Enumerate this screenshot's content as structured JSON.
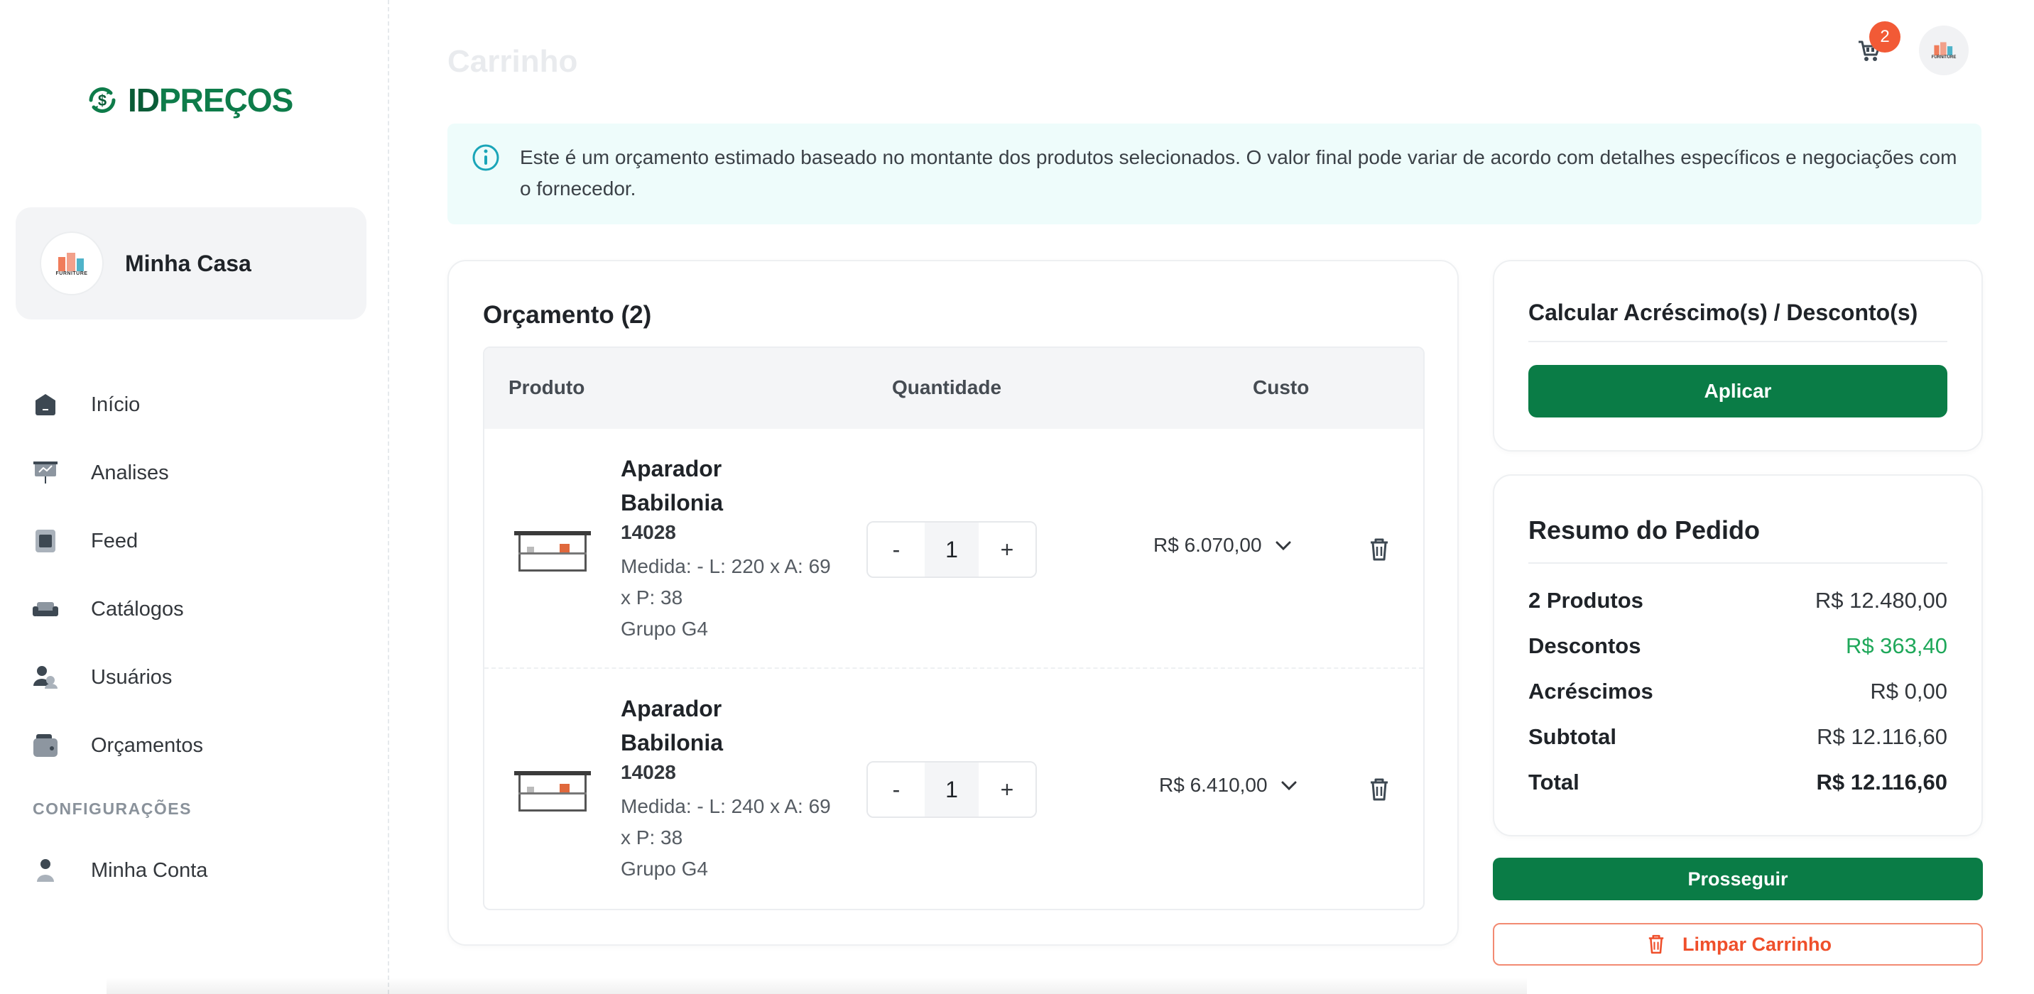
{
  "brand": {
    "prefix": "ID",
    "suffix": "PREÇOS",
    "color": "#0e7c4a"
  },
  "store": {
    "name": "Minha Casa",
    "avatar_text": "FURNITURE"
  },
  "nav": {
    "items": [
      {
        "label": "Início",
        "icon": "home-icon"
      },
      {
        "label": "Analises",
        "icon": "presentation-chart-icon"
      },
      {
        "label": "Feed",
        "icon": "feed-icon"
      },
      {
        "label": "Catálogos",
        "icon": "sofa-icon"
      },
      {
        "label": "Usuários",
        "icon": "users-icon"
      },
      {
        "label": "Orçamentos",
        "icon": "wallet-icon"
      }
    ],
    "section_label": "CONFIGURAÇÕES",
    "settings_items": [
      {
        "label": "Minha Conta",
        "icon": "user-icon"
      }
    ]
  },
  "header": {
    "title": "Carrinho",
    "cart_count": "2",
    "cart_icon": "cart-icon"
  },
  "banner": {
    "icon": "info-icon",
    "text": "Este é um orçamento estimado baseado no montante dos produtos selecionados. O valor final pode variar de acordo com detalhes específicos e negociações com o fornecedor."
  },
  "budget": {
    "title": "Orçamento (2)",
    "columns": [
      "Produto",
      "Quantidade",
      "Custo"
    ],
    "rows": [
      {
        "name": "Aparador Babilonia",
        "code": "14028",
        "desc": "Medida: - L: 220 x A: 69 x P: 38",
        "group": "Grupo G4",
        "qty": "1",
        "price": "R$ 6.070,00"
      },
      {
        "name": "Aparador Babilonia",
        "code": "14028",
        "desc": "Medida: - L: 240 x A: 69 x P: 38",
        "group": "Grupo G4",
        "qty": "1",
        "price": "R$ 6.410,00"
      }
    ],
    "minus_label": "-",
    "plus_label": "+"
  },
  "calc": {
    "title": "Calcular Acréscimo(s) / Desconto(s)",
    "apply_label": "Aplicar"
  },
  "summary": {
    "title": "Resumo do Pedido",
    "products_label": "2 Produtos",
    "products_value": "R$ 12.480,00",
    "discounts_label": "Descontos",
    "discounts_value": "R$ 363,40",
    "discounts_color": "#1fa85a",
    "additions_label": "Acréscimos",
    "additions_value": "R$ 0,00",
    "subtotal_label": "Subtotal",
    "subtotal_value": "R$ 12.116,60",
    "total_label": "Total",
    "total_value": "R$ 12.116,60"
  },
  "actions": {
    "proceed_label": "Prosseguir",
    "clear_label": "Limpar Carrinho"
  }
}
